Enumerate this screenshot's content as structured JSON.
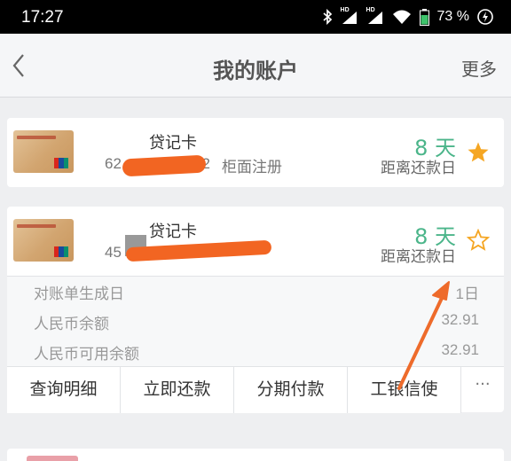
{
  "status_bar": {
    "time": "17:27",
    "battery": "73 %",
    "hd_tag": "HD"
  },
  "nav": {
    "back_icon": "chevron-left-icon",
    "title": "我的账户",
    "more_label": "更多"
  },
  "cards": [
    {
      "name_visible": "贷记卡",
      "number_prefix": "62",
      "number_suffix": "72",
      "register_text": "柜面注册",
      "due_value": "8 天",
      "due_label": "距离还款日",
      "starred": true
    },
    {
      "name_visible": "贷记卡",
      "number_prefix": "45",
      "due_value": "8 天",
      "due_label": "距离还款日",
      "starred": false,
      "details": [
        {
          "label": "对账单生成日",
          "value": "1日"
        },
        {
          "label": "人民币余额",
          "value": "32.91"
        },
        {
          "label": "人民币可用余额",
          "value": "32.91"
        }
      ],
      "actions": [
        "查询明细",
        "立即还款",
        "分期付款",
        "工银信使"
      ],
      "actions_more": "···"
    }
  ],
  "colors": {
    "accent_green": "#4bb58a",
    "star_gold": "#f5a623",
    "redaction_orange": "#f26522",
    "annotation_arrow": "#ee6b2b"
  },
  "icons": [
    "bluetooth-icon",
    "signal-icon",
    "wifi-icon",
    "battery-icon",
    "charging-icon",
    "star-filled-icon",
    "star-outline-icon",
    "unionpay-icon",
    "arrow-annotation-icon"
  ]
}
